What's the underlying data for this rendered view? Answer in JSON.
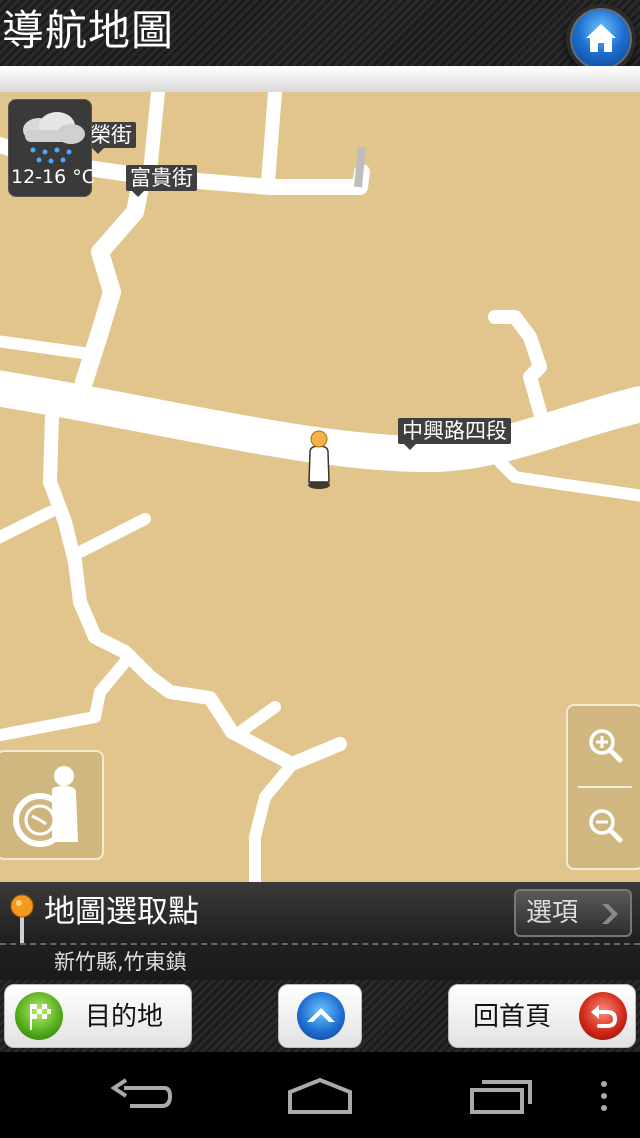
{
  "header": {
    "title": "導航地圖",
    "home_icon": "home-icon"
  },
  "map": {
    "weather": {
      "temperature": "12-16 °C",
      "icon": "rain-cloud-icon"
    },
    "road_labels": {
      "rong_street": "榮街",
      "fugui_street": "富貴街",
      "zhongxing_road": "中興路四段"
    }
  },
  "info": {
    "title": "地圖選取點",
    "options_label": "選項",
    "address": "新竹縣,竹東鎮"
  },
  "buttons": {
    "destination": "目的地",
    "home": "回首頁"
  },
  "colors": {
    "map_bg": "#e1c58c",
    "road": "#ffffff",
    "accent_blue": "#1e6fd1"
  }
}
